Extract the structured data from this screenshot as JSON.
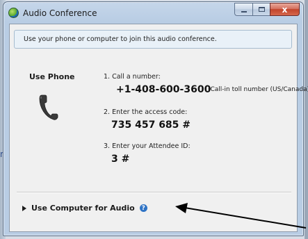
{
  "background": {
    "left_text": "n"
  },
  "window": {
    "title": "Audio Conference",
    "close_glyph": "x"
  },
  "info": {
    "text": "Use your phone or computer to join this audio conference."
  },
  "phone": {
    "heading": "Use Phone",
    "step1_label": "1. Call a number:",
    "number": "+1-408-600-3600",
    "number_note": "(Call-in toll number (US/Canada))",
    "step2_label": "2. Enter the access code:",
    "access_code": "735 457 685 #",
    "step3_label": "3. Enter your Attendee ID:",
    "attendee_id": "3 #"
  },
  "computer": {
    "label": "Use Computer for Audio",
    "help_glyph": "?"
  },
  "colors": {
    "accent": "#2e73c5",
    "close_button": "#c2442b",
    "annotation_arrow": "#000000"
  }
}
